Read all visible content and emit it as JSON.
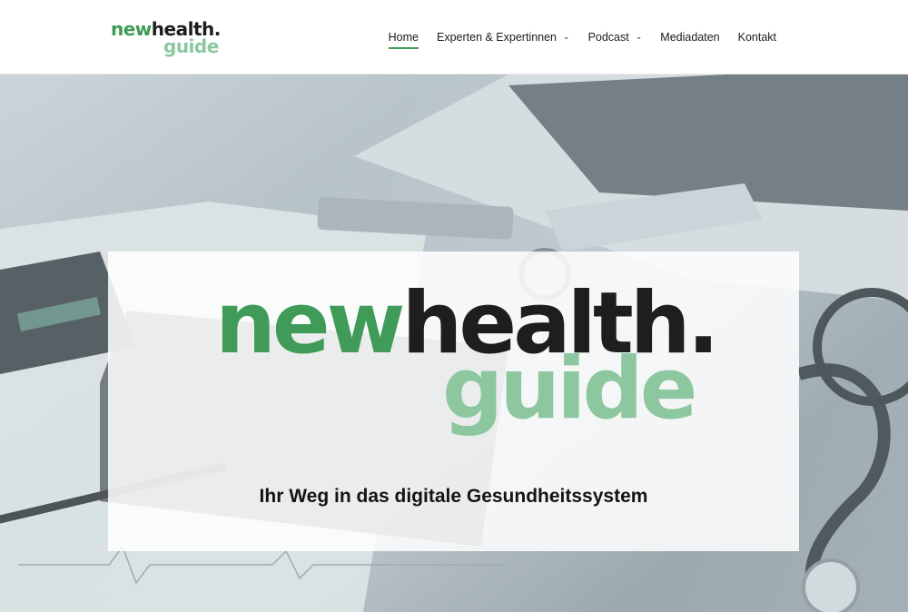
{
  "brand": {
    "logo_part1": "new",
    "logo_part2": "health.",
    "logo_part3": "guide"
  },
  "nav": {
    "items": [
      {
        "label": "Home",
        "active": true,
        "dropdown": false
      },
      {
        "label": "Experten & Expertinnen",
        "active": false,
        "dropdown": true
      },
      {
        "label": "Podcast",
        "active": false,
        "dropdown": true
      },
      {
        "label": "Mediadaten",
        "active": false,
        "dropdown": false
      },
      {
        "label": "Kontakt",
        "active": false,
        "dropdown": false
      }
    ]
  },
  "hero": {
    "logo_part1": "new",
    "logo_part2": "health.",
    "logo_part3": "guide",
    "tagline": "Ihr Weg in das digitale Gesundheitssystem"
  },
  "colors": {
    "accent_green": "#3f9b57",
    "light_green": "#8cc7a0",
    "dark": "#1e1e1e"
  }
}
